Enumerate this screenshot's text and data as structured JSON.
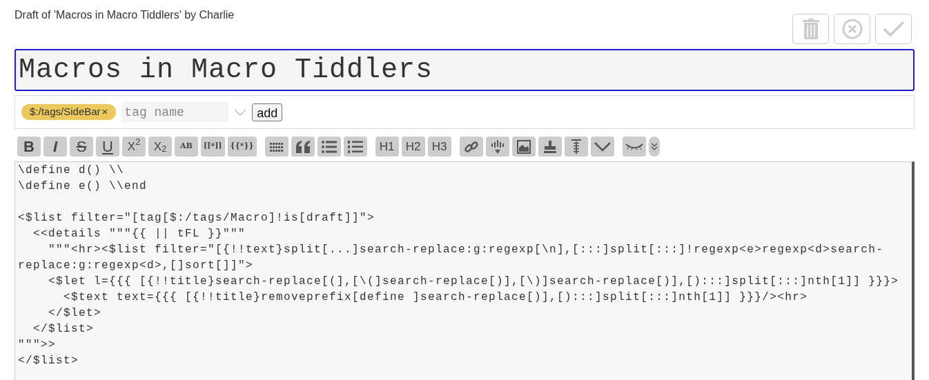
{
  "heading": "Draft of 'Macros in Macro Tiddlers' by Charlie",
  "title_field": {
    "value": "Macros in Macro Tiddlers"
  },
  "tags": [
    {
      "label": "$:/tags/SideBar",
      "remove": "×",
      "color": "#ecc95c"
    }
  ],
  "tag_input": {
    "placeholder": "tag name"
  },
  "add_button": "add",
  "toolbar_groups": [
    [
      {
        "kind": "bold",
        "label": "B"
      },
      {
        "kind": "italic",
        "label": "I"
      },
      {
        "kind": "strike",
        "label": "S"
      },
      {
        "kind": "underline",
        "label": "U"
      },
      {
        "kind": "text",
        "label": "X$^{2}$"
      },
      {
        "kind": "text",
        "label": "X$_{2}$"
      },
      {
        "kind": "small",
        "label": "AB"
      },
      {
        "kind": "small",
        "label": "[[*]]"
      },
      {
        "kind": "small",
        "label": "{{*}}"
      }
    ],
    [
      {
        "kind": "icon"
      },
      {
        "kind": "icon"
      },
      {
        "kind": "icon"
      },
      {
        "kind": "icon"
      }
    ],
    [
      {
        "kind": "text",
        "label": "H1"
      },
      {
        "kind": "text",
        "label": "H2"
      },
      {
        "kind": "text",
        "label": "H3"
      }
    ],
    [
      {
        "kind": "icon"
      },
      {
        "kind": "icon"
      },
      {
        "kind": "icon"
      },
      {
        "kind": "icon"
      },
      {
        "kind": "icon"
      },
      {
        "kind": "icon"
      }
    ],
    [
      {
        "kind": "icon"
      },
      {
        "kind": "icon"
      }
    ]
  ],
  "code_blocks": [
    [
      "\\define d() \\\\",
      "\\define e() \\\\end"
    ],
    [
      "<$list filter=\"[tag[$:/tags/Macro]!is[draft]]\">",
      "  <<details \"\"\"{{ || tFL }}\"\"\"",
      "    \"\"\"<hr><$list filter=\"[{!!text}split[...]search-replace:g:regexp[\\n],[:::]split[:::]!regexp<e>regexp<d>search-",
      "replace:g:regexp<d>,[]sort[]]\">",
      "    <$let l={{{ [{!!title}search-replace[(],[\\(]search-replace[)],[\\)]search-replace[)],[):::]split[:::]nth[1]] }}}>",
      "      <$text text={{{ [{!!title}removeprefix[define ]search-replace[)],[):::]split[:::]nth[1]] }}}/><hr>",
      "    </$let>",
      "  </$list>",
      "\"\"\">>",
      "</$list>"
    ]
  ]
}
